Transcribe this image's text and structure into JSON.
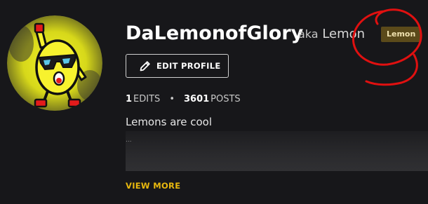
{
  "profile": {
    "username": "DaLemonofGlory",
    "aka_prefix": "aka",
    "aka_name": "Lemon",
    "flair": "Lemon",
    "edit_button_label": "EDIT PROFILE",
    "edits_count": "1",
    "edits_label": "EDITS",
    "separator": "•",
    "posts_count": "3601",
    "posts_label": "POSTS",
    "bio": "Lemons are cool",
    "bio_truncation": "...",
    "view_more_label": "VIEW MORE"
  },
  "icons": {
    "edit": "pencil-icon",
    "avatar": "lemon-avatar-icon"
  },
  "colors": {
    "background": "#17171a",
    "flair_bg": "#5b4a1a",
    "flair_text": "#f0e2b0",
    "accent_link": "#e8b80e",
    "annotation_red": "#e01010"
  }
}
